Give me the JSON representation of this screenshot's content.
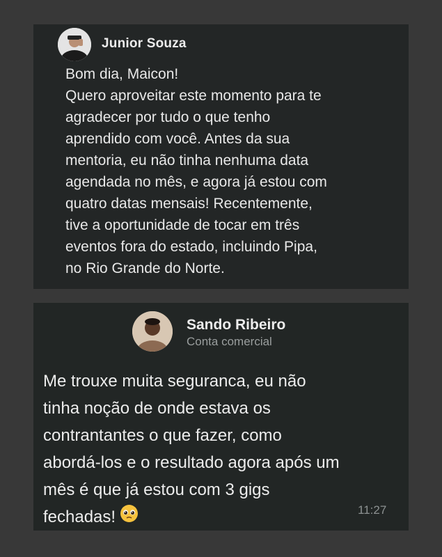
{
  "messages": [
    {
      "author": "Junior Souza",
      "lines": [
        "Bom dia, Maicon!",
        "Quero aproveitar este momento para te",
        "agradecer por tudo o que tenho",
        "aprendido com você. Antes da sua",
        "mentoria, eu não tinha nenhuma data",
        "agendada no mês, e agora já estou com",
        "quatro datas mensais! Recentemente,",
        "tive a oportunidade de tocar em três",
        "eventos fora do estado, incluindo Pipa,",
        "no Rio Grande do Norte."
      ]
    },
    {
      "author": "Sando Ribeiro",
      "subtitle": "Conta comercial",
      "lines": [
        "Me trouxe muita seguranca, eu não",
        "tinha noção de onde estava os",
        "contrantantes o que fazer, como",
        "abordá-los e o resultado agora após um",
        "mês é que já estou com 3 gigs",
        "fechadas!"
      ],
      "emoji": "pleading-face-icon",
      "time": "11:27"
    }
  ]
}
